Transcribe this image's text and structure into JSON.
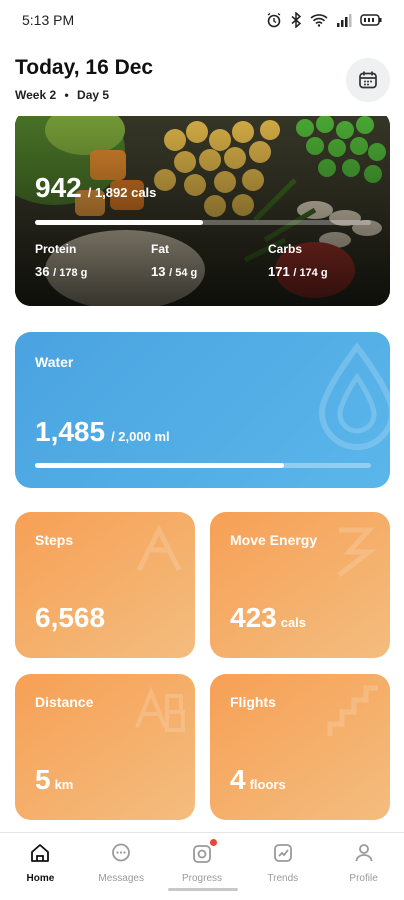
{
  "status_bar": {
    "time": "5:13 PM"
  },
  "header": {
    "title": "Today, 16 Dec",
    "week": "Week 2",
    "separator": "•",
    "day": "Day 5"
  },
  "calories": {
    "value": "942",
    "goal": "/ 1,892 cals",
    "progress": 0.5,
    "macros": [
      {
        "label": "Protein",
        "value": "36",
        "goal": "/ 178 g"
      },
      {
        "label": "Fat",
        "value": "13",
        "goal": "/ 54 g"
      },
      {
        "label": "Carbs",
        "value": "171",
        "goal": "/ 174 g"
      }
    ]
  },
  "water": {
    "label": "Water",
    "value": "1,485",
    "goal": "/ 2,000 ml",
    "progress": 0.74
  },
  "tiles": [
    {
      "label": "Steps",
      "value": "6,568",
      "unit": ""
    },
    {
      "label": "Move Energy",
      "value": "423",
      "unit": "cals"
    },
    {
      "label": "Distance",
      "value": "5",
      "unit": "km"
    },
    {
      "label": "Flights",
      "value": "4",
      "unit": "floors"
    }
  ],
  "tabs": [
    {
      "label": "Home",
      "icon": "home-icon",
      "active": true
    },
    {
      "label": "Messages",
      "icon": "messages-icon",
      "active": false
    },
    {
      "label": "Progress",
      "icon": "progress-icon",
      "active": false,
      "badge": true
    },
    {
      "label": "Trends",
      "icon": "trends-icon",
      "active": false
    },
    {
      "label": "Profile",
      "icon": "profile-icon",
      "active": false
    }
  ],
  "colors": {
    "water": "#4aa3e0",
    "activity": "#f7a055",
    "badge": "#e8453c"
  }
}
